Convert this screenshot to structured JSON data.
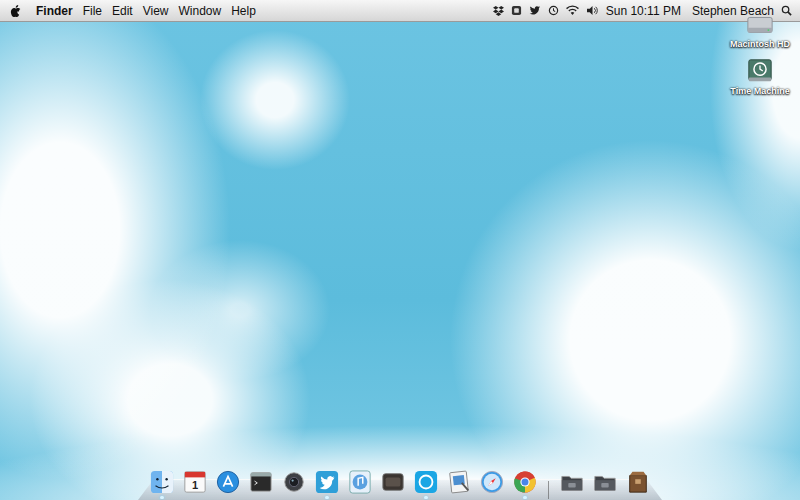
{
  "menu_bar": {
    "app": "Finder",
    "menus": [
      "File",
      "Edit",
      "View",
      "Window",
      "Help"
    ],
    "status_icons": [
      {
        "kind": "dropbox"
      },
      {
        "kind": "app"
      },
      {
        "kind": "twitter"
      },
      {
        "kind": "timemachine"
      },
      {
        "kind": "wifi"
      },
      {
        "kind": "volume"
      }
    ],
    "clock": "Sun 10:11 PM",
    "user": "Stephen Beach"
  },
  "desktop_icons": [
    {
      "label": "Macintosh HD",
      "kind": "disk"
    },
    {
      "label": "Time Machine",
      "kind": "timemachine"
    }
  ],
  "dock": {
    "apps": [
      {
        "kind": "finder",
        "running": true,
        "text": ""
      },
      {
        "kind": "calendar",
        "running": false,
        "text": "1"
      },
      {
        "kind": "appstore",
        "running": false,
        "text": ""
      },
      {
        "kind": "terminal",
        "running": false,
        "text": ""
      },
      {
        "kind": "camera",
        "running": false,
        "text": ""
      },
      {
        "kind": "twitter",
        "running": true,
        "text": ""
      },
      {
        "kind": "itunes",
        "running": false,
        "text": ""
      },
      {
        "kind": "dark",
        "running": false,
        "text": ""
      },
      {
        "kind": "skype",
        "running": true,
        "text": ""
      },
      {
        "kind": "preview",
        "running": false,
        "text": ""
      },
      {
        "kind": "safari",
        "running": false,
        "text": ""
      },
      {
        "kind": "chrome",
        "running": true,
        "text": ""
      }
    ],
    "docs": [
      {
        "kind": "folder"
      },
      {
        "kind": "folder"
      },
      {
        "kind": "box"
      }
    ]
  }
}
